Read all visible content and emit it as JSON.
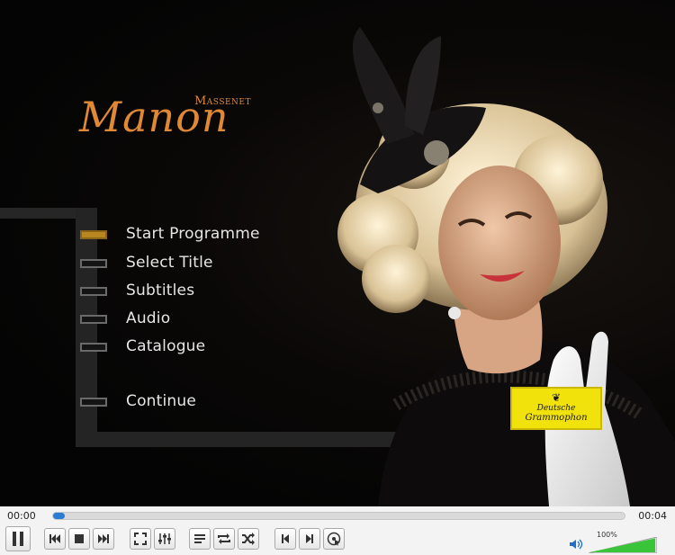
{
  "title": {
    "composer": "Massenet",
    "opera": "Manon"
  },
  "menu": {
    "items": [
      {
        "label": "Start Programme",
        "active": true
      },
      {
        "label": "Select Title",
        "active": false
      },
      {
        "label": "Subtitles",
        "active": false
      },
      {
        "label": "Audio",
        "active": false
      },
      {
        "label": "Catalogue",
        "active": false
      },
      {
        "label": "Continue",
        "active": false
      }
    ]
  },
  "logo": {
    "line1": "Deutsche",
    "line2": "Grammophon",
    "color": "#f2e20c"
  },
  "player": {
    "elapsed": "00:00",
    "total": "00:04",
    "progress": 0.02,
    "volume_label": "100%",
    "volume": 1.0,
    "accent_color": "#2a7bd4",
    "volume_color": "#39c43a",
    "buttons": [
      "pause-icon",
      "previous-chapter-icon",
      "stop-icon",
      "next-chapter-icon",
      "fullscreen-icon",
      "extended-settings-icon",
      "playlist-icon",
      "loop-icon",
      "shuffle-icon",
      "frame-back-icon",
      "frame-forward-icon",
      "disc-menu-icon"
    ]
  }
}
